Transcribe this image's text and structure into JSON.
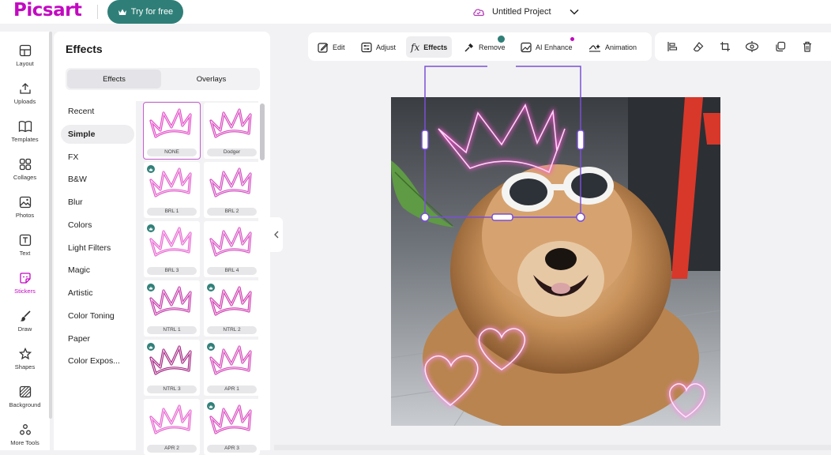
{
  "header": {
    "logo": "Picsart",
    "try_button": "Try for free",
    "project_title": "Untitled Project"
  },
  "leftnav": [
    {
      "label": "Layout",
      "icon": "layout-icon"
    },
    {
      "label": "Uploads",
      "icon": "upload-icon"
    },
    {
      "label": "Templates",
      "icon": "templates-icon"
    },
    {
      "label": "Collages",
      "icon": "collages-icon"
    },
    {
      "label": "Photos",
      "icon": "photos-icon"
    },
    {
      "label": "Text",
      "icon": "text-icon"
    },
    {
      "label": "Stickers",
      "icon": "stickers-icon",
      "active": true
    },
    {
      "label": "Draw",
      "icon": "brush-icon"
    },
    {
      "label": "Shapes",
      "icon": "shapes-icon"
    },
    {
      "label": "Background",
      "icon": "background-icon"
    },
    {
      "label": "More Tools",
      "icon": "more-tools-icon"
    }
  ],
  "panel": {
    "title": "Effects",
    "tabs": [
      "Effects",
      "Overlays"
    ],
    "active_tab": "Effects",
    "categories": [
      "Recent",
      "Simple",
      "FX",
      "B&W",
      "Blur",
      "Colors",
      "Light Filters",
      "Magic",
      "Artistic",
      "Color Toning",
      "Paper",
      "Color Expos..."
    ],
    "active_category": "Simple",
    "thumbnails": [
      {
        "name": "NONE",
        "premium": false,
        "selected": true
      },
      {
        "name": "Dodger",
        "premium": false
      },
      {
        "name": "BRL 1",
        "premium": true
      },
      {
        "name": "BRL 2",
        "premium": false
      },
      {
        "name": "BRL 3",
        "premium": true
      },
      {
        "name": "BRL 4",
        "premium": false
      },
      {
        "name": "NTRL 1",
        "premium": true
      },
      {
        "name": "NTRL 2",
        "premium": true
      },
      {
        "name": "NTRL 3",
        "premium": true
      },
      {
        "name": "APR 1",
        "premium": true
      },
      {
        "name": "APR 2",
        "premium": false
      },
      {
        "name": "APR 3",
        "premium": true
      }
    ]
  },
  "toolbar": {
    "items": [
      "Edit",
      "Adjust",
      "Effects",
      "Remove",
      "AI Enhance",
      "Animation"
    ],
    "active": "Effects"
  },
  "colors": {
    "brand": "#c209c1",
    "accent_teal": "#2f7f78",
    "selection": "#7a4fd6"
  }
}
